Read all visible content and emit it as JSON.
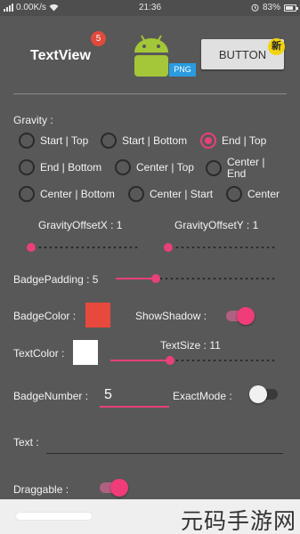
{
  "status_bar": {
    "network_speed": "0.00K/s",
    "time": "21:36",
    "battery": "83%",
    "battery_level": 0.83
  },
  "header": {
    "title": "TextView",
    "title_badge": "5",
    "image_badge": "PNG",
    "button_label": "BUTTON",
    "button_badge": "新"
  },
  "gravity": {
    "label": "Gravity :",
    "options": [
      {
        "label": "Start | Top",
        "selected": false
      },
      {
        "label": "Start | Bottom",
        "selected": false
      },
      {
        "label": "End | Top",
        "selected": true
      },
      {
        "label": "End | Bottom",
        "selected": false
      },
      {
        "label": "Center | Top",
        "selected": false
      },
      {
        "label": "Center | End",
        "selected": false
      },
      {
        "label": "Center | Bottom",
        "selected": false
      },
      {
        "label": "Center | Start",
        "selected": false
      },
      {
        "label": "Center",
        "selected": false
      }
    ]
  },
  "offset": {
    "x_label": "GravityOffsetX : 1",
    "y_label": "GravityOffsetY : 1",
    "x_value": 1,
    "y_value": 1,
    "x_progress": 0.04,
    "y_progress": 0.04
  },
  "badge_padding": {
    "label": "BadgePadding : 5",
    "value": 5,
    "progress": 0.25
  },
  "badge_color": {
    "label": "BadgeColor :",
    "color": "#e8493d"
  },
  "show_shadow": {
    "label": "ShowShadow :",
    "on": true
  },
  "text_color": {
    "label": "TextColor :",
    "color": "#ffffff"
  },
  "text_size": {
    "label": "TextSize : 11",
    "value": 11,
    "progress": 0.36
  },
  "badge_number": {
    "label": "BadgeNumber :",
    "value": "5"
  },
  "exact_mode": {
    "label": "ExactMode :",
    "on": false
  },
  "text": {
    "label": "Text :",
    "value": ""
  },
  "draggable": {
    "label": "Draggable :",
    "on": true
  },
  "watermark": "元码手游网",
  "colors": {
    "accent": "#e8407a",
    "background": "#585858",
    "badge": "#e04a3c",
    "android_green": "#a4c639",
    "png_tag": "#2a9ce0"
  }
}
